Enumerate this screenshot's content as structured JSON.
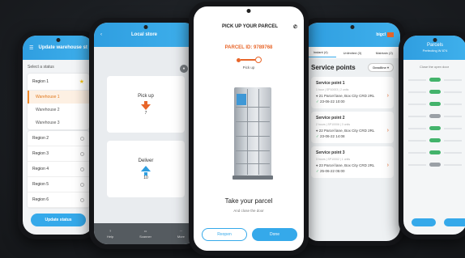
{
  "phone1": {
    "title": "Update warehouse st",
    "subtitle": "Select a status",
    "regions": [
      "Region 1",
      "Region 2",
      "Region 3",
      "Region 4",
      "Region 5",
      "Region 6"
    ],
    "warehouses": [
      "Warehouse 1",
      "Warehouse 2",
      "Warehouse 3"
    ],
    "button": "Update status"
  },
  "phone2": {
    "title": "Local store",
    "pickup_label": "Pick up",
    "pickup_count": "7",
    "deliver_label": "Deliver",
    "deliver_count": "10",
    "footer": [
      "Help",
      "Scanner",
      "More"
    ]
  },
  "phone3": {
    "title": "PICK UP YOUR PARCEL",
    "parcel_id": "PARCEL ID: 9789768",
    "step_label": "Pick up",
    "take_title": "Take your parcel",
    "take_sub": "And close the door",
    "reopen": "Reopen",
    "done": "Done"
  },
  "phone4": {
    "brand": "bigcl",
    "tabs": [
      "Instant (4)",
      "Unlimited (3)",
      "Maintain (2)"
    ],
    "heading": "Service points",
    "sort": "Deadline",
    "points": [
      {
        "name": "Service point 1",
        "meta": "1 hour  |  SP10003  |  2 units",
        "address": "21 Parcel lane, Box City CRD 2RL",
        "date": "23-06-22 10:00"
      },
      {
        "name": "Service point 2",
        "meta": "2 hours  |  SP10006  |  3 units",
        "address": "22 Parcel lane, Box City CRD 2RL",
        "date": "23-06-22 14:08"
      },
      {
        "name": "Service point 3",
        "meta": "3 hours  |  SP10002  |  1 units",
        "address": "23 Parcel lane, Box City CRD 2RL",
        "date": "25-06-22 05:00"
      }
    ]
  },
  "phone5": {
    "title": "Parcels",
    "subtitle": "Perfecting W 874",
    "note": "Close the open door"
  }
}
